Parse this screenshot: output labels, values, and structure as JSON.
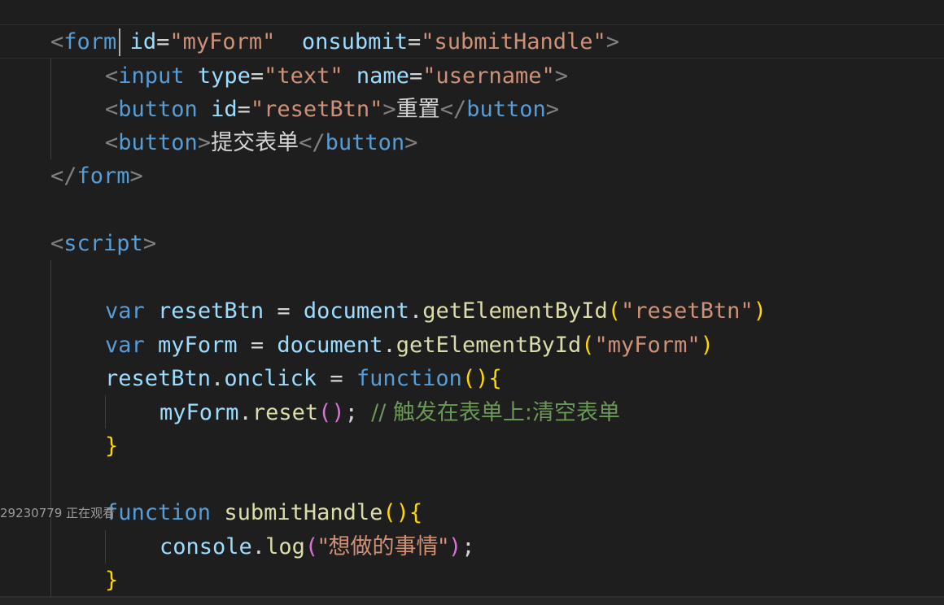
{
  "code": {
    "form_open": {
      "tag": "form",
      "attr_id": "id",
      "id_value": "\"myForm\"",
      "attr_onsubmit": "onsubmit",
      "onsubmit_value": "\"submitHandle\""
    },
    "input_line": {
      "tag": "input",
      "attr_type": "type",
      "type_value": "\"text\"",
      "attr_name": "name",
      "name_value": "\"username\""
    },
    "reset_button_line": {
      "tag": "button",
      "attr_id": "id",
      "id_value": "\"resetBtn\"",
      "text": "重置",
      "close_tag": "button"
    },
    "submit_button_line": {
      "tag": "button",
      "text": "提交表单",
      "close_tag": "button"
    },
    "form_close": {
      "tag": "form"
    },
    "script_open": {
      "tag": "script"
    },
    "var_reset": {
      "keyword": "var",
      "name": "resetBtn",
      "eq": " = ",
      "object": "document",
      "method": "getElementById",
      "arg": "\"resetBtn\""
    },
    "var_form": {
      "keyword": "var",
      "name": "myForm",
      "eq": " = ",
      "object": "document",
      "method": "getElementById",
      "arg": "\"myForm\""
    },
    "onclick_line": {
      "object": "resetBtn",
      "prop": "onclick",
      "eq": " = ",
      "keyword": "function"
    },
    "reset_call": {
      "object": "myForm",
      "method": "reset",
      "comment": "// 触发在表单上:清空表单"
    },
    "fn_decl": {
      "keyword": "function",
      "name": "submitHandle"
    },
    "console_line": {
      "object": "console",
      "method": "log",
      "arg": "\"想做的事情\""
    }
  },
  "overlay": {
    "watermark": "29230779 正在观看"
  },
  "colors": {
    "background": "#1e1e1e",
    "tag": "#569cd6",
    "attribute": "#9cdcfe",
    "string": "#ce9178",
    "function": "#dcdcaa",
    "comment": "#6a9955",
    "bracket_gold": "#ffd700",
    "bracket_pink": "#da70d6",
    "bracket_blue": "#179fff"
  }
}
